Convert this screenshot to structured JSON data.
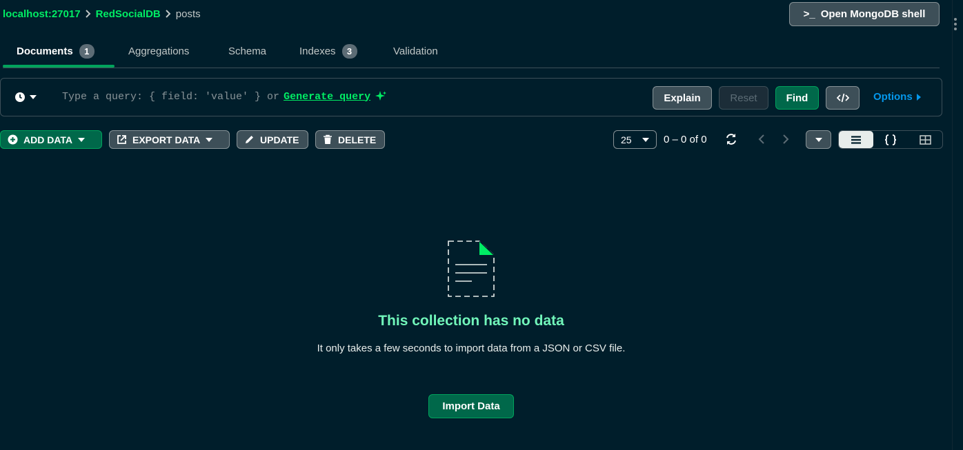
{
  "breadcrumb": {
    "host": "localhost:27017",
    "database": "RedSocialDB",
    "collection": "posts"
  },
  "shell_button": {
    "prompt": ">_",
    "label": "Open MongoDB shell"
  },
  "tabs": [
    {
      "label": "Documents",
      "badge": "1"
    },
    {
      "label": "Aggregations"
    },
    {
      "label": "Schema"
    },
    {
      "label": "Indexes",
      "badge": "3"
    },
    {
      "label": "Validation"
    }
  ],
  "query": {
    "placeholder": "Type a query: { field: 'value' } or",
    "generate_link": "Generate query",
    "explain": "Explain",
    "reset": "Reset",
    "find": "Find",
    "options": "Options"
  },
  "toolbar": {
    "add_data": "ADD DATA",
    "export_data": "EXPORT DATA",
    "update": "UPDATE",
    "delete": "DELETE",
    "page_size": "25",
    "range": "0 – 0 of 0"
  },
  "empty_state": {
    "title": "This collection has no data",
    "description": "It only takes a few seconds to import data from a JSON or CSV file.",
    "import_button": "Import Data"
  },
  "colors": {
    "background": "#001e2b",
    "accent": "#00ed64",
    "button_green": "#00684a",
    "link_blue": "#0498ec"
  }
}
